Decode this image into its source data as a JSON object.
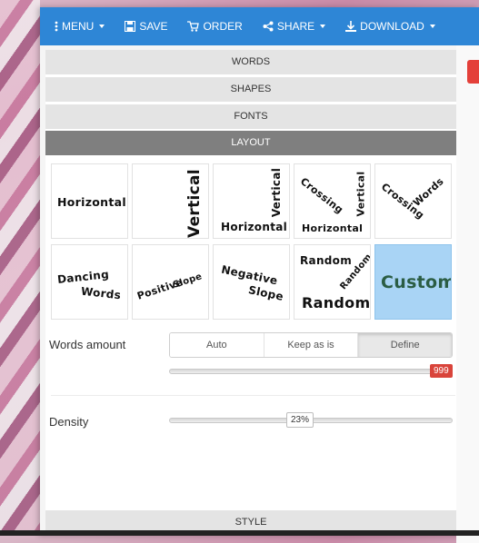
{
  "toolbar": {
    "menu": "MENU",
    "save": "SAVE",
    "order": "ORDER",
    "share": "SHARE",
    "download": "DOWNLOAD"
  },
  "sections": {
    "words": "WORDS",
    "shapes": "SHAPES",
    "fonts": "FONTS",
    "layout": "LAYOUT",
    "style": "STYLE"
  },
  "layouts": {
    "horizontal": "Horizontal",
    "vertical": "Vertical",
    "vh_vertical": "Vertical",
    "vh_horizontal": "Horizontal",
    "crossing": "Crossing",
    "cv_vertical": "Vertical",
    "cv_horizontal": "Horizontal",
    "cw_crossing": "Crossing",
    "cw_words": "Words",
    "dancing": "Dancing",
    "dancing_words": "Words",
    "positive": "Positive",
    "positive_slope": "Slope",
    "negative": "Negative",
    "negative_slope": "Slope",
    "random1": "Random",
    "random2": "Random",
    "random3": "Random",
    "custom": "Custom",
    "selected": "custom"
  },
  "words_amount": {
    "label": "Words amount",
    "options": [
      "Auto",
      "Keep as is",
      "Define"
    ],
    "selected": "Define",
    "value": "999"
  },
  "density": {
    "label": "Density",
    "value": "23%",
    "fraction": 0.23
  },
  "colors": {
    "toolbar": "#2e86d6",
    "active_section": "#7f7f7f",
    "selected_tile": "#a9d4f5",
    "badge": "#d9443b",
    "custom_text": "#2b5d44"
  }
}
